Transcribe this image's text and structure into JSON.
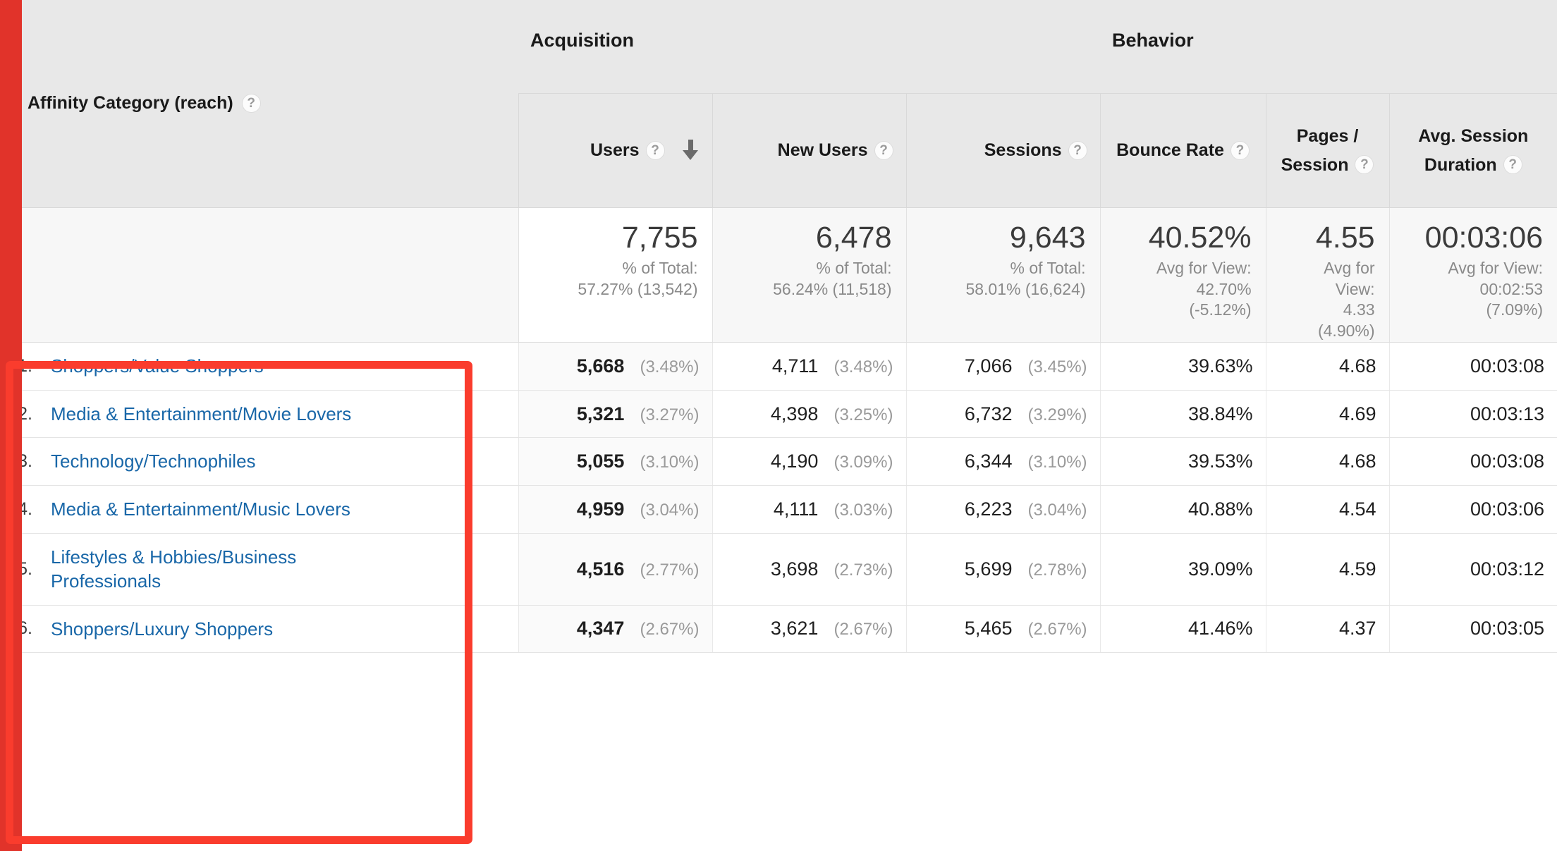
{
  "dimension": {
    "label": "Affinity Category (reach)",
    "help_icon": "help-circle-icon"
  },
  "groups": {
    "acquisition": "Acquisition",
    "behavior": "Behavior"
  },
  "columns": {
    "users": "Users",
    "new_users": "New Users",
    "sessions": "Sessions",
    "bounce_rate": "Bounce Rate",
    "pages_session_line1": "Pages /",
    "pages_session_line2": "Session",
    "avg_duration_line1": "Avg. Session",
    "avg_duration_line2": "Duration",
    "sort_icon": "sort-descending-arrow-icon"
  },
  "totals": {
    "users": {
      "value": "7,755",
      "sub_line1": "% of Total:",
      "sub_line2": "57.27% (13,542)"
    },
    "new_users": {
      "value": "6,478",
      "sub_line1": "% of Total:",
      "sub_line2": "56.24% (11,518)"
    },
    "sessions": {
      "value": "9,643",
      "sub_line1": "% of Total:",
      "sub_line2": "58.01% (16,624)"
    },
    "bounce_rate": {
      "value": "40.52%",
      "sub_line1": "Avg for View:",
      "sub_line2": "42.70%",
      "sub_line3": "(-5.12%)"
    },
    "pages_session": {
      "value": "4.55",
      "sub_line1": "Avg for",
      "sub_line2": "View:",
      "sub_line3": "4.33",
      "sub_line4": "(4.90%)"
    },
    "avg_duration": {
      "value": "00:03:06",
      "sub_line1": "Avg for View:",
      "sub_line2": "00:02:53",
      "sub_line3": "(7.09%)"
    }
  },
  "rows": [
    {
      "rank": "1.",
      "name": "Shoppers/Value Shoppers",
      "users": "5,668",
      "users_pct": "(3.48%)",
      "new_users": "4,711",
      "new_users_pct": "(3.48%)",
      "sessions": "7,066",
      "sessions_pct": "(3.45%)",
      "bounce_rate": "39.63%",
      "pages_session": "4.68",
      "avg_duration": "00:03:08"
    },
    {
      "rank": "2.",
      "name": "Media & Entertainment/Movie Lovers",
      "users": "5,321",
      "users_pct": "(3.27%)",
      "new_users": "4,398",
      "new_users_pct": "(3.25%)",
      "sessions": "6,732",
      "sessions_pct": "(3.29%)",
      "bounce_rate": "38.84%",
      "pages_session": "4.69",
      "avg_duration": "00:03:13"
    },
    {
      "rank": "3.",
      "name": "Technology/Technophiles",
      "users": "5,055",
      "users_pct": "(3.10%)",
      "new_users": "4,190",
      "new_users_pct": "(3.09%)",
      "sessions": "6,344",
      "sessions_pct": "(3.10%)",
      "bounce_rate": "39.53%",
      "pages_session": "4.68",
      "avg_duration": "00:03:08"
    },
    {
      "rank": "4.",
      "name": "Media & Entertainment/Music Lovers",
      "users": "4,959",
      "users_pct": "(3.04%)",
      "new_users": "4,111",
      "new_users_pct": "(3.03%)",
      "sessions": "6,223",
      "sessions_pct": "(3.04%)",
      "bounce_rate": "40.88%",
      "pages_session": "4.54",
      "avg_duration": "00:03:06"
    },
    {
      "rank": "5.",
      "name": "Lifestyles & Hobbies/Business Professionals",
      "users": "4,516",
      "users_pct": "(2.77%)",
      "new_users": "3,698",
      "new_users_pct": "(2.73%)",
      "sessions": "5,699",
      "sessions_pct": "(2.78%)",
      "bounce_rate": "39.09%",
      "pages_session": "4.59",
      "avg_duration": "00:03:12"
    },
    {
      "rank": "6.",
      "name": "Shoppers/Luxury Shoppers",
      "users": "4,347",
      "users_pct": "(2.67%)",
      "new_users": "3,621",
      "new_users_pct": "(2.67%)",
      "sessions": "5,465",
      "sessions_pct": "(2.67%)",
      "bounce_rate": "41.46%",
      "pages_session": "4.37",
      "avg_duration": "00:03:05"
    }
  ],
  "annotation": {
    "shape": "rectangle-highlight",
    "color": "#FA3C2D"
  },
  "left_bar": {
    "color": "#E1332A"
  }
}
